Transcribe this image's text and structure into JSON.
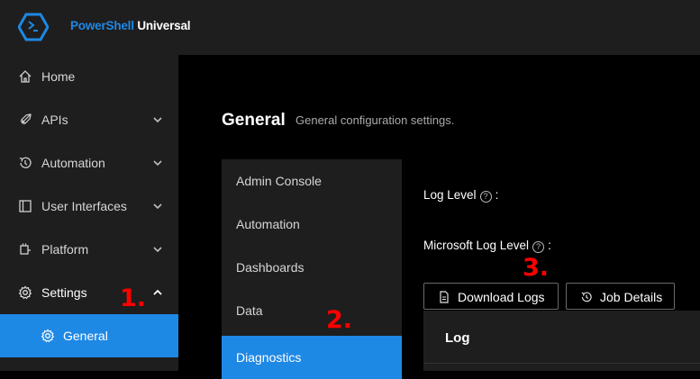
{
  "app": {
    "brand_part1": "PowerShell",
    "brand_part2": " Universal",
    "logo_icon": "powershell-chevron-hex-icon",
    "accent_color": "#1e88e5"
  },
  "sidebar": {
    "items": [
      {
        "label": "Home",
        "icon": "home-icon"
      },
      {
        "label": "APIs",
        "icon": "rocket-icon",
        "expanded": false
      },
      {
        "label": "Automation",
        "icon": "history-icon",
        "expanded": false
      },
      {
        "label": "User Interfaces",
        "icon": "window-icon",
        "expanded": false
      },
      {
        "label": "Platform",
        "icon": "plug-icon",
        "expanded": false
      },
      {
        "label": "Settings",
        "icon": "gear-icon",
        "expanded": true
      },
      {
        "label": "General",
        "icon": "gear-icon",
        "active": true
      }
    ]
  },
  "main": {
    "title": "General",
    "subtitle": "General configuration settings.",
    "tabs": [
      {
        "label": "Admin Console"
      },
      {
        "label": "Automation"
      },
      {
        "label": "Dashboards"
      },
      {
        "label": "Data"
      },
      {
        "label": "Diagnostics",
        "selected": true
      }
    ],
    "fields": {
      "log_level": "Log Level",
      "ms_log_level": "Microsoft Log Level",
      "help_glyph": "?",
      "colon": ":"
    },
    "buttons": {
      "download_logs": "Download Logs",
      "job_details": "Job Details"
    },
    "log_panel": {
      "header": "Log"
    }
  },
  "annotations": {
    "step1": "1.",
    "step2": "2.",
    "step3": "3.",
    "color": "#ff0000"
  }
}
